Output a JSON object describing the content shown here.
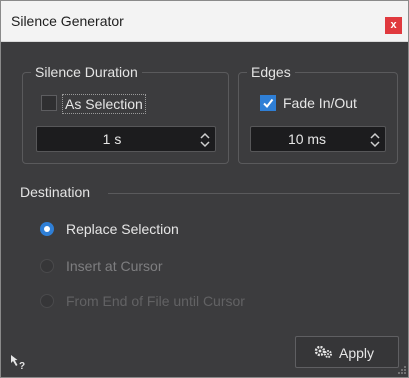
{
  "window": {
    "title": "Silence Generator",
    "close_glyph": "x"
  },
  "silence_duration": {
    "title": "Silence Duration",
    "as_selection_label": "As Selection",
    "as_selection_checked": false,
    "duration_value": "1 s"
  },
  "edges": {
    "title": "Edges",
    "fade_label": "Fade In/Out",
    "fade_checked": true,
    "fade_value": "10 ms"
  },
  "destination": {
    "title": "Destination",
    "options": [
      {
        "label": "Replace Selection",
        "selected": true,
        "enabled": true
      },
      {
        "label": "Insert at Cursor",
        "selected": false,
        "enabled": false
      },
      {
        "label": "From End of File until Cursor",
        "selected": false,
        "enabled": false
      }
    ]
  },
  "footer": {
    "apply_label": "Apply",
    "help_icon": "whats-this-help-icon"
  },
  "colors": {
    "accent": "#2f7fd6",
    "close": "#e0393e",
    "background": "#3c3c3e"
  }
}
